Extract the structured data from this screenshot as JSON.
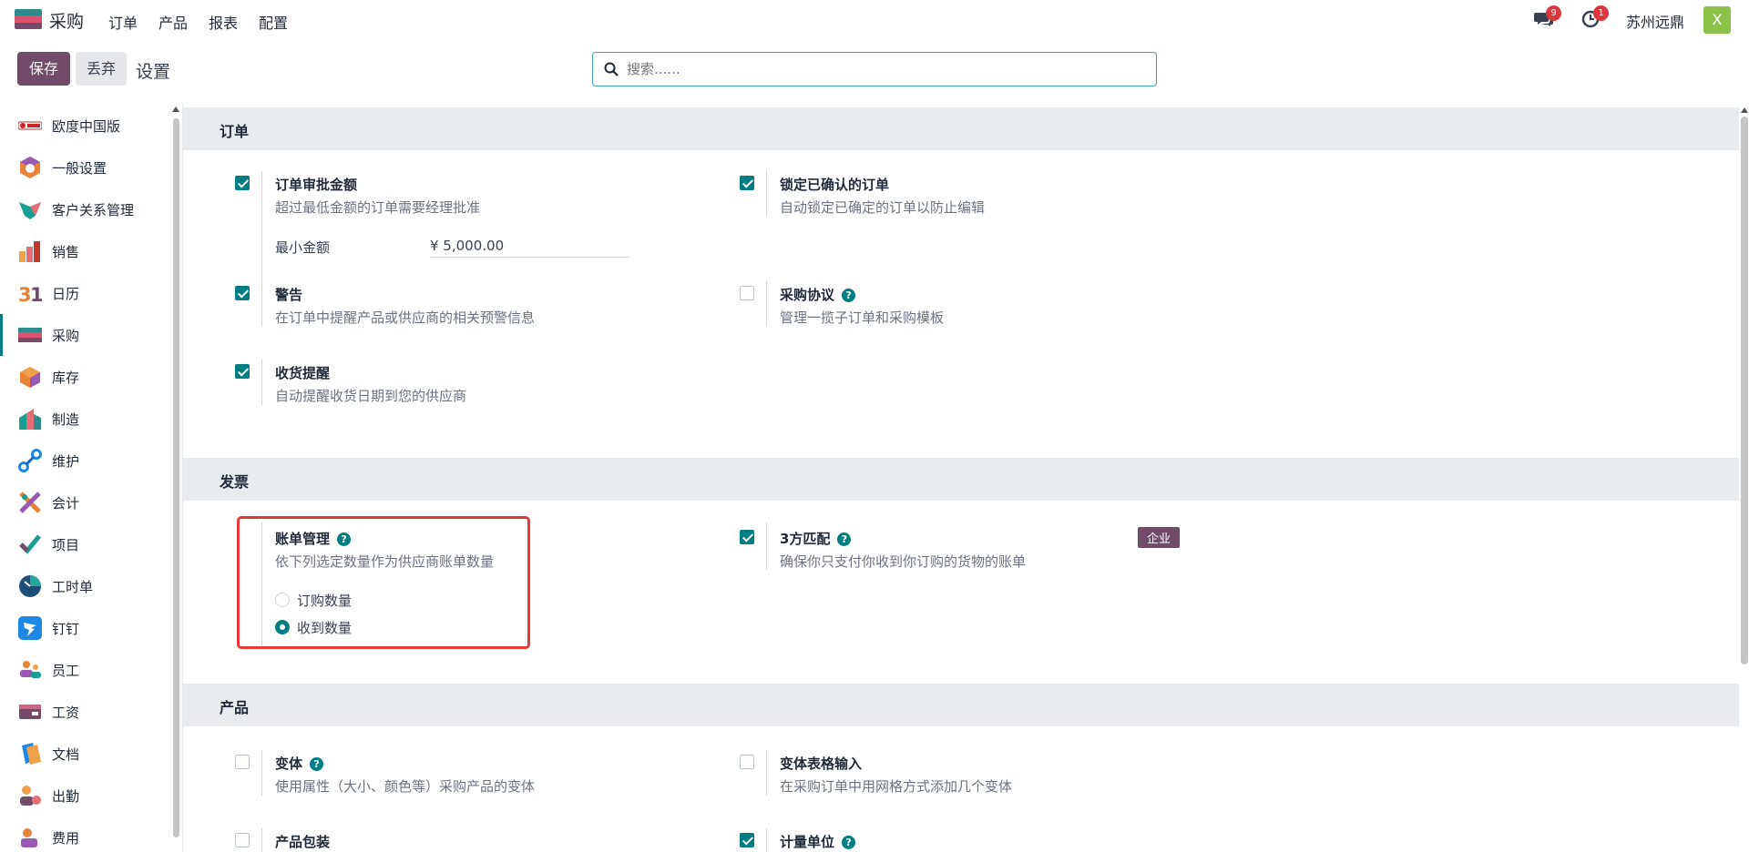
{
  "topbar": {
    "app_name": "采购",
    "menu": [
      "订单",
      "产品",
      "报表",
      "配置"
    ],
    "messages_count": "9",
    "activities_count": "1",
    "company": "苏州远鼎",
    "avatar_letter": "X"
  },
  "control": {
    "save_label": "保存",
    "discard_label": "丢弃",
    "breadcrumb": "设置",
    "search_placeholder": "搜索......"
  },
  "sidebar": {
    "items": [
      {
        "label": "欧度中国版",
        "icon": "odoo-cn-icon"
      },
      {
        "label": "一般设置",
        "icon": "general-settings-icon"
      },
      {
        "label": "客户关系管理",
        "icon": "crm-icon"
      },
      {
        "label": "销售",
        "icon": "sales-icon"
      },
      {
        "label": "日历",
        "icon": "calendar-icon"
      },
      {
        "label": "采购",
        "icon": "purchase-icon"
      },
      {
        "label": "库存",
        "icon": "inventory-icon"
      },
      {
        "label": "制造",
        "icon": "manufacturing-icon"
      },
      {
        "label": "维护",
        "icon": "maintenance-icon"
      },
      {
        "label": "会计",
        "icon": "accounting-icon"
      },
      {
        "label": "项目",
        "icon": "project-icon"
      },
      {
        "label": "工时单",
        "icon": "timesheet-icon"
      },
      {
        "label": "钉钉",
        "icon": "dingtalk-icon"
      },
      {
        "label": "员工",
        "icon": "employees-icon"
      },
      {
        "label": "工资",
        "icon": "payroll-icon"
      },
      {
        "label": "文档",
        "icon": "documents-icon"
      },
      {
        "label": "出勤",
        "icon": "attendance-icon"
      },
      {
        "label": "费用",
        "icon": "expenses-icon"
      }
    ],
    "active_label": "采购"
  },
  "sections": {
    "orders": {
      "title": "订单",
      "approval": {
        "title": "订单审批金额",
        "desc": "超过最低金额的订单需要经理批准",
        "checked": true,
        "min_label": "最小金额",
        "min_value": "¥ 5,000.00"
      },
      "lock": {
        "title": "锁定已确认的订单",
        "desc": "自动锁定已确定的订单以防止编辑",
        "checked": true
      },
      "warning": {
        "title": "警告",
        "desc": "在订单中提醒产品或供应商的相关预警信息",
        "checked": true
      },
      "agreement": {
        "title": "采购协议",
        "desc": "管理一揽子订单和采购模板",
        "checked": false
      },
      "receipt": {
        "title": "收货提醒",
        "desc": "自动提醒收货日期到您的供应商",
        "checked": true
      }
    },
    "invoicing": {
      "title": "发票",
      "bill": {
        "title": "账单管理",
        "desc": "依下列选定数量作为供应商账单数量",
        "option1": "订购数量",
        "option2": "收到数量",
        "selected": "收到数量"
      },
      "three_way": {
        "title": "3方匹配",
        "desc": "确保你只支付你收到你订购的货物的账单",
        "checked": true,
        "badge": "企业"
      }
    },
    "products": {
      "title": "产品",
      "variants": {
        "title": "变体",
        "desc": "使用属性（大小、颜色等）采购产品的变体",
        "checked": false
      },
      "variant_grid": {
        "title": "变体表格输入",
        "desc": "在采购订单中用网格方式添加几个变体",
        "checked": false
      },
      "packaging": {
        "title": "产品包装",
        "checked": false
      },
      "uom": {
        "title": "计量单位",
        "checked": true
      }
    }
  }
}
